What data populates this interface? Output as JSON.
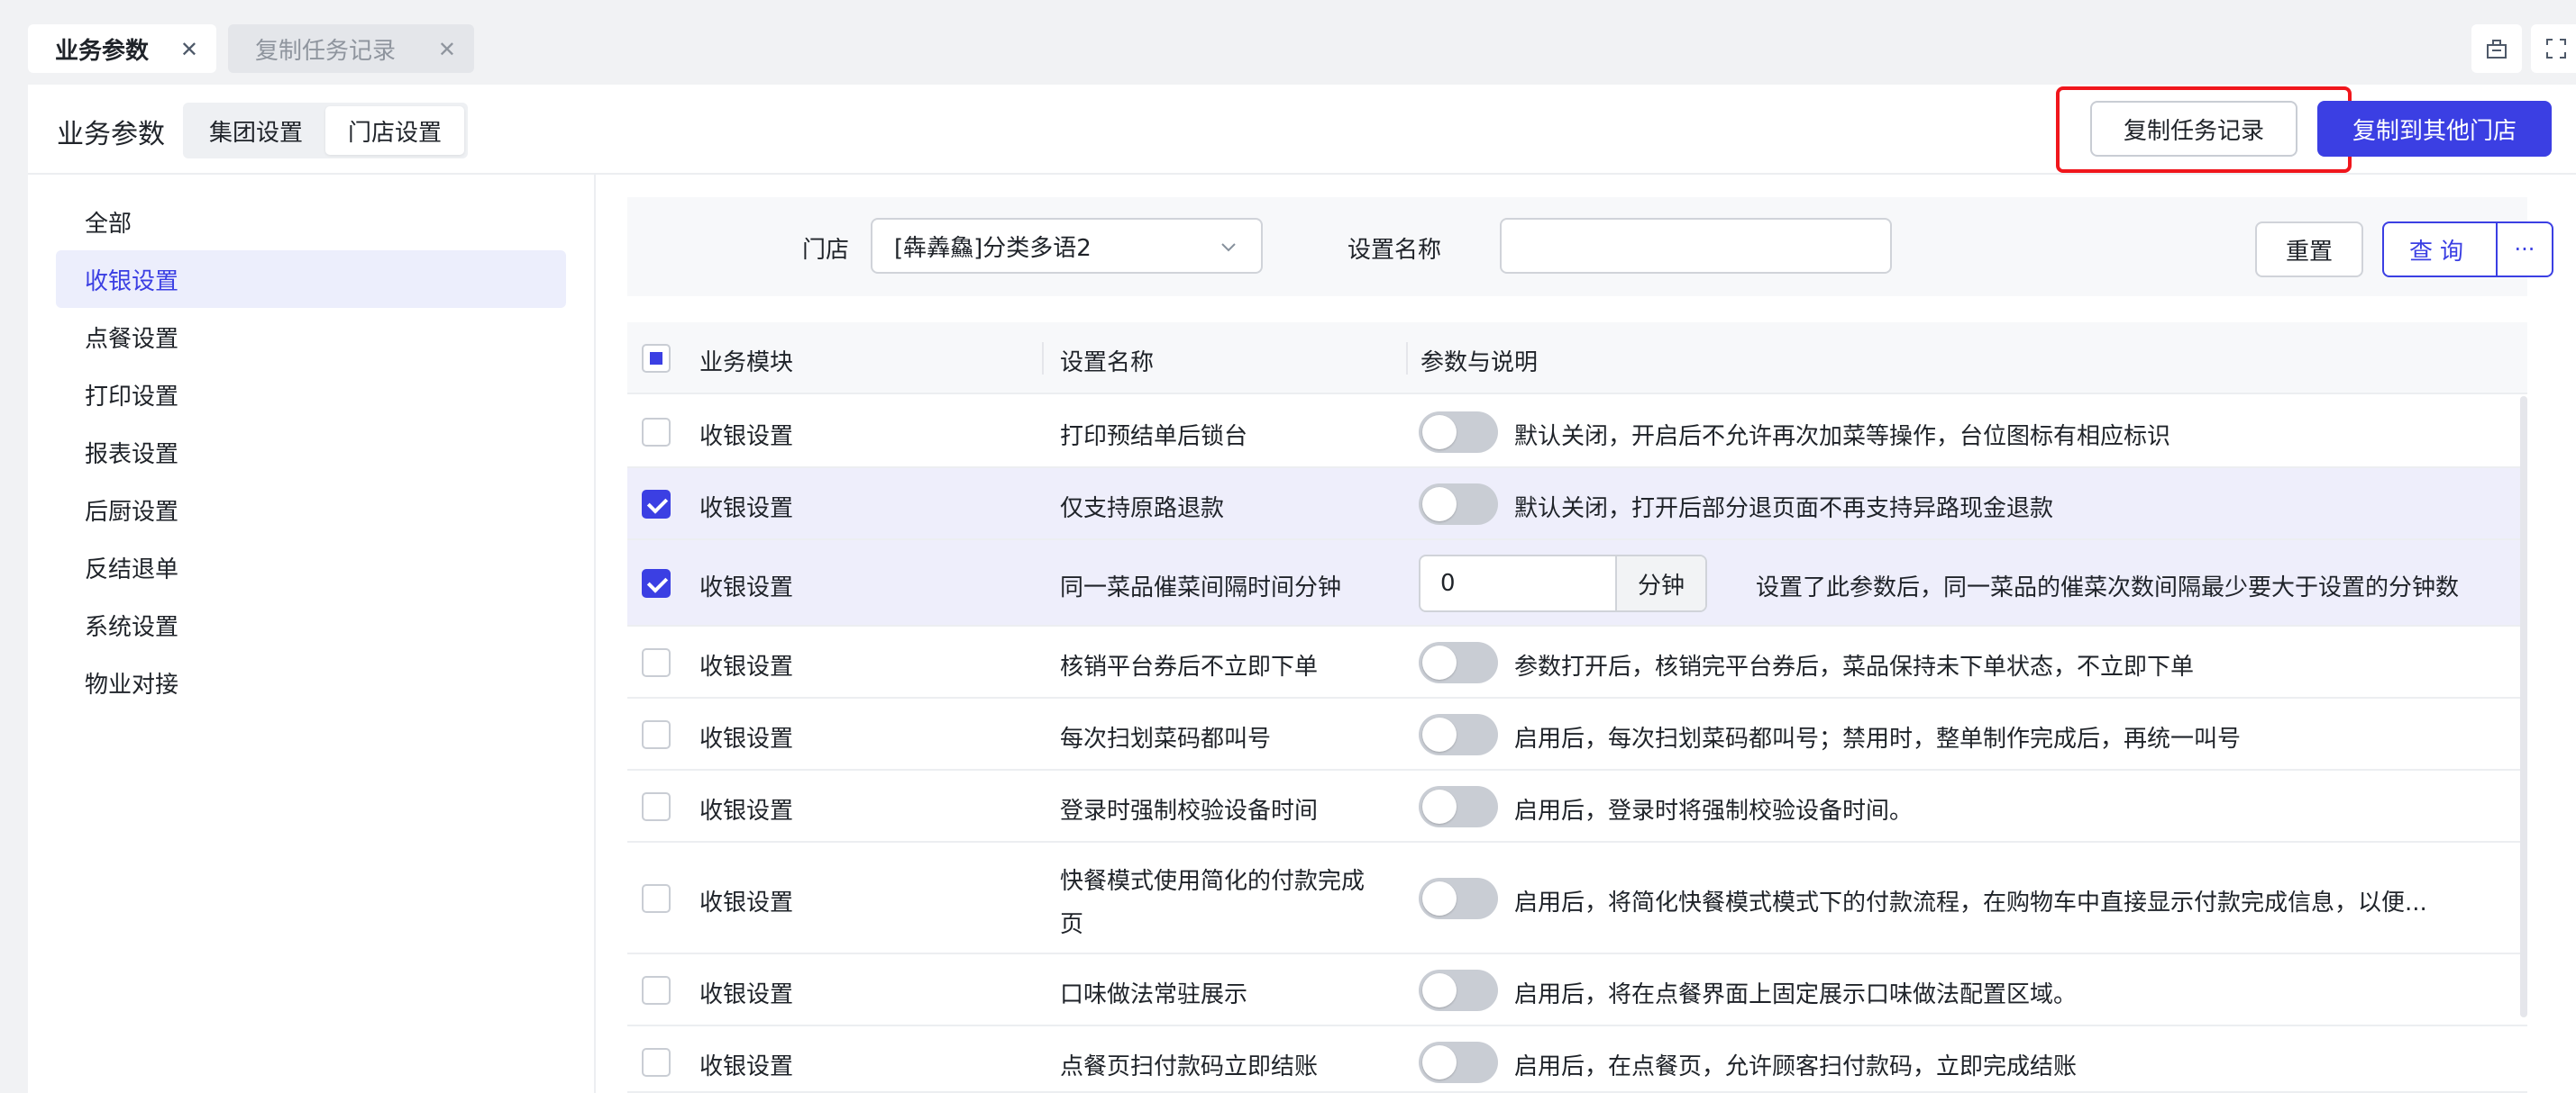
{
  "tabs": [
    {
      "label": "业务参数",
      "active": true
    },
    {
      "label": "复制任务记录",
      "active": false
    }
  ],
  "header": {
    "title": "业务参数",
    "segments": [
      "集团设置",
      "门店设置"
    ],
    "active_segment": "门店设置",
    "copy_record_button": "复制任务记录",
    "copy_to_store_button": "复制到其他门店"
  },
  "sidebar": {
    "items": [
      "全部",
      "收银设置",
      "点餐设置",
      "打印设置",
      "报表设置",
      "后厨设置",
      "反结退单",
      "系统设置",
      "物业对接"
    ],
    "active": "收银设置"
  },
  "filter": {
    "store_label": "门店",
    "store_value": "[犇羴鱻]分类多语2",
    "name_label": "设置名称",
    "name_value": "",
    "reset_button": "重置",
    "query_button": "查询",
    "more_button": "···"
  },
  "table": {
    "columns": [
      "业务模块",
      "设置名称",
      "参数与说明"
    ],
    "rows": [
      {
        "module": "收银设置",
        "name": "打印预结单后锁台",
        "control": "toggle",
        "on": false,
        "checked": false,
        "desc": "默认关闭，开启后不允许再次加菜等操作，台位图标有相应标识"
      },
      {
        "module": "收银设置",
        "name": "仅支持原路退款",
        "control": "toggle",
        "on": false,
        "checked": true,
        "desc": "默认关闭，打开后部分退页面不再支持异路现金退款"
      },
      {
        "module": "收银设置",
        "name": "同一菜品催菜间隔时间分钟",
        "control": "number",
        "value": "0",
        "unit": "分钟",
        "checked": true,
        "desc": "设置了此参数后，同一菜品的催菜次数间隔最少要大于设置的分钟数"
      },
      {
        "module": "收银设置",
        "name": "核销平台券后不立即下单",
        "control": "toggle",
        "on": false,
        "checked": false,
        "desc": "参数打开后，核销完平台券后，菜品保持未下单状态，不立即下单"
      },
      {
        "module": "收银设置",
        "name": "每次扫划菜码都叫号",
        "control": "toggle",
        "on": false,
        "checked": false,
        "desc": "启用后，每次扫划菜码都叫号；禁用时，整单制作完成后，再统一叫号"
      },
      {
        "module": "收银设置",
        "name": "登录时强制校验设备时间",
        "control": "toggle",
        "on": false,
        "checked": false,
        "desc": "启用后，登录时将强制校验设备时间。"
      },
      {
        "module": "收银设置",
        "name_lines": [
          "快餐模式使用简化的付款完成",
          "页"
        ],
        "control": "toggle",
        "on": false,
        "checked": false,
        "desc": "启用后，将简化快餐模式模式下的付款流程，在购物车中直接显示付款完成信息，以便..."
      },
      {
        "module": "收银设置",
        "name": "口味做法常驻展示",
        "control": "toggle",
        "on": false,
        "checked": false,
        "desc": "启用后，将在点餐界面上固定展示口味做法配置区域。"
      },
      {
        "module": "收银设置",
        "name": "点餐页扫付款码立即结账",
        "control": "toggle",
        "on": false,
        "checked": false,
        "desc": "启用后，在点餐页，允许顾客扫付款码，立即完成结账"
      }
    ]
  },
  "colors": {
    "primary": "#3b3fe3",
    "highlight_border": "#f0161c",
    "selected_row": "#eeeefb"
  }
}
